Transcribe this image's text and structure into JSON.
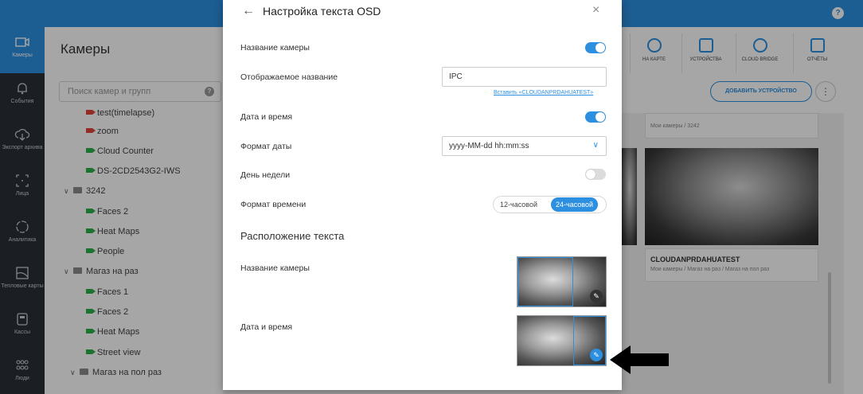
{
  "topbar": {
    "help": "?"
  },
  "nav": [
    {
      "label": "Камеры",
      "icon": "camera-icon",
      "active": true
    },
    {
      "label": "События",
      "icon": "bell-icon"
    },
    {
      "label": "Экспорт архива",
      "icon": "cloud-download-icon"
    },
    {
      "label": "Лица",
      "icon": "face-frame-icon"
    },
    {
      "label": "Аналитика",
      "icon": "analytics-icon"
    },
    {
      "label": "Тепловые карты",
      "icon": "heatmap-icon"
    },
    {
      "label": "Кассы",
      "icon": "cash-register-icon"
    },
    {
      "label": "Люди",
      "icon": "people-icon"
    }
  ],
  "cameras": {
    "title": "Камеры",
    "search_placeholder": "Поиск камер и групп",
    "search_help": "?",
    "tree": [
      {
        "type": "cam",
        "label": "test(timelapse)",
        "red": true
      },
      {
        "type": "cam",
        "label": "zoom",
        "red": true
      },
      {
        "type": "cam",
        "label": "Cloud Counter"
      },
      {
        "type": "cam",
        "label": "DS-2CD2543G2-IWS"
      },
      {
        "type": "folder",
        "label": "3242"
      },
      {
        "type": "cam",
        "label": "Faces 2"
      },
      {
        "type": "cam",
        "label": "Heat Maps"
      },
      {
        "type": "cam",
        "label": "People"
      },
      {
        "type": "folder",
        "label": "Магаз на раз"
      },
      {
        "type": "cam",
        "label": "Faces 1"
      },
      {
        "type": "cam",
        "label": "Faces 2"
      },
      {
        "type": "cam",
        "label": "Heat Maps"
      },
      {
        "type": "cam",
        "label": "Street view"
      },
      {
        "type": "folder",
        "label": "Магаз на пол раз"
      }
    ]
  },
  "content": {
    "toolbar": [
      "НА КАРТЕ",
      "УСТРОЙСТВА",
      "CLOUD BRIDGE",
      "ОТЧЁТЫ"
    ],
    "add_device": "ДОБАВИТЬ УСТРОЙСТВО",
    "more": "⋮",
    "card1_path": "Мои камеры / 3242",
    "card2_title": "CLOUDANPRDAHUATEST",
    "card2_path": "Мои камеры / Магаз на раз / Магаз на пол раз"
  },
  "modal": {
    "back": "←",
    "title": "Настройка текста OSD",
    "close": "×",
    "camera_name_label": "Название камеры",
    "camera_name_on": true,
    "display_name_label": "Отображаемое название",
    "display_name_value": "IPC",
    "insert_link": "Вставить «CLOUDANPRDAHUATEST»",
    "datetime_label": "Дата и время",
    "datetime_on": true,
    "date_format_label": "Формат даты",
    "date_format_value": "yyyy-MM-dd hh:mm:ss",
    "weekday_label": "День недели",
    "weekday_on": false,
    "time_format_label": "Формат времени",
    "time_format_options": [
      "12-часовой",
      "24-часовой"
    ],
    "time_format_selected": "24-часовой",
    "position_section": "Расположение текста",
    "pos_camera_name_label": "Название камеры",
    "pos_datetime_label": "Дата и время"
  }
}
